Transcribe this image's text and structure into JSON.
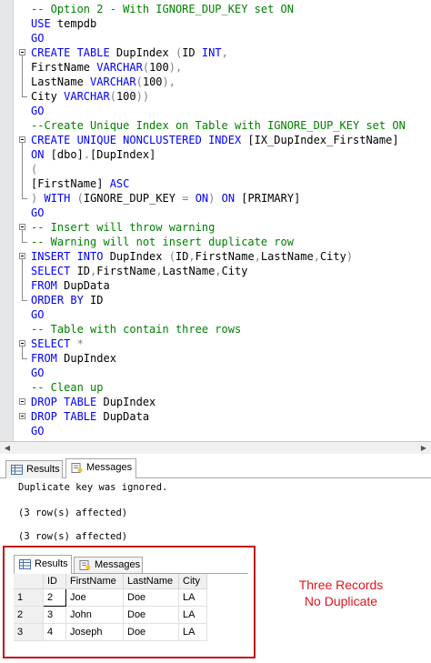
{
  "code_lines": [
    [
      [
        "-- Option 2 - With IGNORE_DUP_KEY set ON",
        "cm"
      ]
    ],
    [
      [
        "USE",
        "kw"
      ],
      [
        " tempdb",
        ""
      ]
    ],
    [
      [
        "GO",
        "kw"
      ]
    ],
    [
      [
        "CREATE TABLE",
        "kw"
      ],
      [
        " DupIndex ",
        ""
      ],
      [
        "(",
        "gr"
      ],
      [
        "ID ",
        ""
      ],
      [
        "INT",
        "kw"
      ],
      [
        ",",
        "gr"
      ]
    ],
    [
      [
        "FirstName ",
        ""
      ],
      [
        "VARCHAR",
        "kw"
      ],
      [
        "(",
        "gr"
      ],
      [
        "100",
        ""
      ],
      [
        "),",
        "gr"
      ]
    ],
    [
      [
        "LastName ",
        ""
      ],
      [
        "VARCHAR",
        "kw"
      ],
      [
        "(",
        "gr"
      ],
      [
        "100",
        ""
      ],
      [
        "),",
        "gr"
      ]
    ],
    [
      [
        "City ",
        ""
      ],
      [
        "VARCHAR",
        "kw"
      ],
      [
        "(",
        "gr"
      ],
      [
        "100",
        ""
      ],
      [
        "))",
        "gr"
      ]
    ],
    [
      [
        "GO",
        "kw"
      ]
    ],
    [
      [
        "--Create Unique Index on Table with IGNORE_DUP_KEY set ON",
        "cm"
      ]
    ],
    [
      [
        "CREATE UNIQUE NONCLUSTERED INDEX",
        "kw"
      ],
      [
        " [IX_DupIndex_FirstName]",
        ""
      ]
    ],
    [
      [
        "ON",
        "kw"
      ],
      [
        " [dbo]",
        ""
      ],
      [
        ".",
        "gr"
      ],
      [
        "[DupIndex]",
        ""
      ]
    ],
    [
      [
        "(",
        "gr"
      ]
    ],
    [
      [
        "[FirstName] ",
        ""
      ],
      [
        "ASC",
        "kw"
      ]
    ],
    [
      [
        ")",
        "gr"
      ],
      [
        " ",
        ""
      ],
      [
        "WITH",
        "kw"
      ],
      [
        " ",
        ""
      ],
      [
        "(",
        "gr"
      ],
      [
        "IGNORE_DUP_KEY ",
        ""
      ],
      [
        "=",
        "gr"
      ],
      [
        " ",
        ""
      ],
      [
        "ON",
        "kw"
      ],
      [
        ")",
        "gr"
      ],
      [
        " ",
        ""
      ],
      [
        "ON",
        "kw"
      ],
      [
        " [PRIMARY]",
        ""
      ]
    ],
    [
      [
        "GO",
        "kw"
      ]
    ],
    [
      [
        "-- Insert will throw warning",
        "cm"
      ]
    ],
    [
      [
        "-- Warning will not insert duplicate row",
        "cm"
      ]
    ],
    [
      [
        "INSERT INTO",
        "kw"
      ],
      [
        " DupIndex ",
        ""
      ],
      [
        "(",
        "gr"
      ],
      [
        "ID",
        ""
      ],
      [
        ",",
        "gr"
      ],
      [
        "FirstName",
        ""
      ],
      [
        ",",
        "gr"
      ],
      [
        "LastName",
        ""
      ],
      [
        ",",
        "gr"
      ],
      [
        "City",
        ""
      ],
      [
        ")",
        "gr"
      ]
    ],
    [
      [
        "SELECT",
        "kw"
      ],
      [
        " ID",
        ""
      ],
      [
        ",",
        "gr"
      ],
      [
        "FirstName",
        ""
      ],
      [
        ",",
        "gr"
      ],
      [
        "LastName",
        ""
      ],
      [
        ",",
        "gr"
      ],
      [
        "City",
        ""
      ]
    ],
    [
      [
        "FROM",
        "kw"
      ],
      [
        " DupData",
        ""
      ]
    ],
    [
      [
        "ORDER BY",
        "kw"
      ],
      [
        " ID",
        ""
      ]
    ],
    [
      [
        "GO",
        "kw"
      ]
    ],
    [
      [
        "-- Table with contain three rows",
        "cm"
      ]
    ],
    [
      [
        "SELECT",
        "kw"
      ],
      [
        " ",
        ""
      ],
      [
        "*",
        "gr"
      ]
    ],
    [
      [
        "FROM",
        "kw"
      ],
      [
        " DupIndex",
        ""
      ]
    ],
    [
      [
        "GO",
        "kw"
      ]
    ],
    [
      [
        "-- Clean up",
        "cm"
      ]
    ],
    [
      [
        "DROP TABLE",
        "kw"
      ],
      [
        " DupIndex",
        ""
      ]
    ],
    [
      [
        "DROP TABLE",
        "kw"
      ],
      [
        " DupData",
        ""
      ]
    ],
    [
      [
        "GO",
        "kw"
      ]
    ]
  ],
  "result_tabs": {
    "results": "Results",
    "messages": "Messages"
  },
  "messages": {
    "line1": "Duplicate key was ignored.",
    "line2": "(3 row(s) affected)",
    "line3": "(3 row(s) affected)"
  },
  "inset": {
    "tabs": {
      "results": "Results",
      "messages": "Messages"
    },
    "columns": [
      "",
      "ID",
      "FirstName",
      "LastName",
      "City"
    ],
    "rows": [
      [
        "1",
        "2",
        "Joe",
        "Doe",
        "LA"
      ],
      [
        "2",
        "3",
        "John",
        "Doe",
        "LA"
      ],
      [
        "3",
        "4",
        "Joseph",
        "Doe",
        "LA"
      ]
    ]
  },
  "annotation": {
    "line1": "Three Records",
    "line2": "No Duplicate"
  },
  "colors": {
    "keyword": "#0000ff",
    "comment": "#008000",
    "operator": "#808080",
    "annotation": "#e0141b",
    "highlight_border": "#c0141b"
  }
}
